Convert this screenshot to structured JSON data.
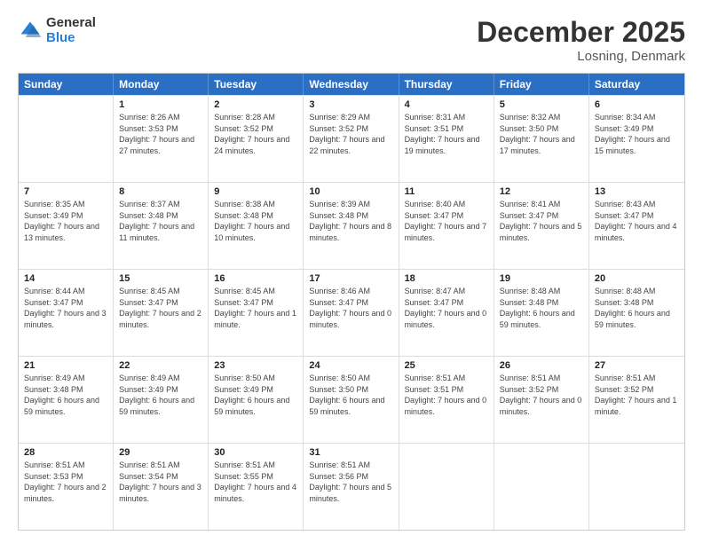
{
  "logo": {
    "general": "General",
    "blue": "Blue"
  },
  "title": {
    "month": "December 2025",
    "location": "Losning, Denmark"
  },
  "header_days": [
    "Sunday",
    "Monday",
    "Tuesday",
    "Wednesday",
    "Thursday",
    "Friday",
    "Saturday"
  ],
  "rows": [
    [
      {
        "date": "",
        "sunrise": "",
        "sunset": "",
        "daylight": ""
      },
      {
        "date": "1",
        "sunrise": "Sunrise: 8:26 AM",
        "sunset": "Sunset: 3:53 PM",
        "daylight": "Daylight: 7 hours and 27 minutes."
      },
      {
        "date": "2",
        "sunrise": "Sunrise: 8:28 AM",
        "sunset": "Sunset: 3:52 PM",
        "daylight": "Daylight: 7 hours and 24 minutes."
      },
      {
        "date": "3",
        "sunrise": "Sunrise: 8:29 AM",
        "sunset": "Sunset: 3:52 PM",
        "daylight": "Daylight: 7 hours and 22 minutes."
      },
      {
        "date": "4",
        "sunrise": "Sunrise: 8:31 AM",
        "sunset": "Sunset: 3:51 PM",
        "daylight": "Daylight: 7 hours and 19 minutes."
      },
      {
        "date": "5",
        "sunrise": "Sunrise: 8:32 AM",
        "sunset": "Sunset: 3:50 PM",
        "daylight": "Daylight: 7 hours and 17 minutes."
      },
      {
        "date": "6",
        "sunrise": "Sunrise: 8:34 AM",
        "sunset": "Sunset: 3:49 PM",
        "daylight": "Daylight: 7 hours and 15 minutes."
      }
    ],
    [
      {
        "date": "7",
        "sunrise": "Sunrise: 8:35 AM",
        "sunset": "Sunset: 3:49 PM",
        "daylight": "Daylight: 7 hours and 13 minutes."
      },
      {
        "date": "8",
        "sunrise": "Sunrise: 8:37 AM",
        "sunset": "Sunset: 3:48 PM",
        "daylight": "Daylight: 7 hours and 11 minutes."
      },
      {
        "date": "9",
        "sunrise": "Sunrise: 8:38 AM",
        "sunset": "Sunset: 3:48 PM",
        "daylight": "Daylight: 7 hours and 10 minutes."
      },
      {
        "date": "10",
        "sunrise": "Sunrise: 8:39 AM",
        "sunset": "Sunset: 3:48 PM",
        "daylight": "Daylight: 7 hours and 8 minutes."
      },
      {
        "date": "11",
        "sunrise": "Sunrise: 8:40 AM",
        "sunset": "Sunset: 3:47 PM",
        "daylight": "Daylight: 7 hours and 7 minutes."
      },
      {
        "date": "12",
        "sunrise": "Sunrise: 8:41 AM",
        "sunset": "Sunset: 3:47 PM",
        "daylight": "Daylight: 7 hours and 5 minutes."
      },
      {
        "date": "13",
        "sunrise": "Sunrise: 8:43 AM",
        "sunset": "Sunset: 3:47 PM",
        "daylight": "Daylight: 7 hours and 4 minutes."
      }
    ],
    [
      {
        "date": "14",
        "sunrise": "Sunrise: 8:44 AM",
        "sunset": "Sunset: 3:47 PM",
        "daylight": "Daylight: 7 hours and 3 minutes."
      },
      {
        "date": "15",
        "sunrise": "Sunrise: 8:45 AM",
        "sunset": "Sunset: 3:47 PM",
        "daylight": "Daylight: 7 hours and 2 minutes."
      },
      {
        "date": "16",
        "sunrise": "Sunrise: 8:45 AM",
        "sunset": "Sunset: 3:47 PM",
        "daylight": "Daylight: 7 hours and 1 minute."
      },
      {
        "date": "17",
        "sunrise": "Sunrise: 8:46 AM",
        "sunset": "Sunset: 3:47 PM",
        "daylight": "Daylight: 7 hours and 0 minutes."
      },
      {
        "date": "18",
        "sunrise": "Sunrise: 8:47 AM",
        "sunset": "Sunset: 3:47 PM",
        "daylight": "Daylight: 7 hours and 0 minutes."
      },
      {
        "date": "19",
        "sunrise": "Sunrise: 8:48 AM",
        "sunset": "Sunset: 3:48 PM",
        "daylight": "Daylight: 6 hours and 59 minutes."
      },
      {
        "date": "20",
        "sunrise": "Sunrise: 8:48 AM",
        "sunset": "Sunset: 3:48 PM",
        "daylight": "Daylight: 6 hours and 59 minutes."
      }
    ],
    [
      {
        "date": "21",
        "sunrise": "Sunrise: 8:49 AM",
        "sunset": "Sunset: 3:48 PM",
        "daylight": "Daylight: 6 hours and 59 minutes."
      },
      {
        "date": "22",
        "sunrise": "Sunrise: 8:49 AM",
        "sunset": "Sunset: 3:49 PM",
        "daylight": "Daylight: 6 hours and 59 minutes."
      },
      {
        "date": "23",
        "sunrise": "Sunrise: 8:50 AM",
        "sunset": "Sunset: 3:49 PM",
        "daylight": "Daylight: 6 hours and 59 minutes."
      },
      {
        "date": "24",
        "sunrise": "Sunrise: 8:50 AM",
        "sunset": "Sunset: 3:50 PM",
        "daylight": "Daylight: 6 hours and 59 minutes."
      },
      {
        "date": "25",
        "sunrise": "Sunrise: 8:51 AM",
        "sunset": "Sunset: 3:51 PM",
        "daylight": "Daylight: 7 hours and 0 minutes."
      },
      {
        "date": "26",
        "sunrise": "Sunrise: 8:51 AM",
        "sunset": "Sunset: 3:52 PM",
        "daylight": "Daylight: 7 hours and 0 minutes."
      },
      {
        "date": "27",
        "sunrise": "Sunrise: 8:51 AM",
        "sunset": "Sunset: 3:52 PM",
        "daylight": "Daylight: 7 hours and 1 minute."
      }
    ],
    [
      {
        "date": "28",
        "sunrise": "Sunrise: 8:51 AM",
        "sunset": "Sunset: 3:53 PM",
        "daylight": "Daylight: 7 hours and 2 minutes."
      },
      {
        "date": "29",
        "sunrise": "Sunrise: 8:51 AM",
        "sunset": "Sunset: 3:54 PM",
        "daylight": "Daylight: 7 hours and 3 minutes."
      },
      {
        "date": "30",
        "sunrise": "Sunrise: 8:51 AM",
        "sunset": "Sunset: 3:55 PM",
        "daylight": "Daylight: 7 hours and 4 minutes."
      },
      {
        "date": "31",
        "sunrise": "Sunrise: 8:51 AM",
        "sunset": "Sunset: 3:56 PM",
        "daylight": "Daylight: 7 hours and 5 minutes."
      },
      {
        "date": "",
        "sunrise": "",
        "sunset": "",
        "daylight": ""
      },
      {
        "date": "",
        "sunrise": "",
        "sunset": "",
        "daylight": ""
      },
      {
        "date": "",
        "sunrise": "",
        "sunset": "",
        "daylight": ""
      }
    ]
  ]
}
